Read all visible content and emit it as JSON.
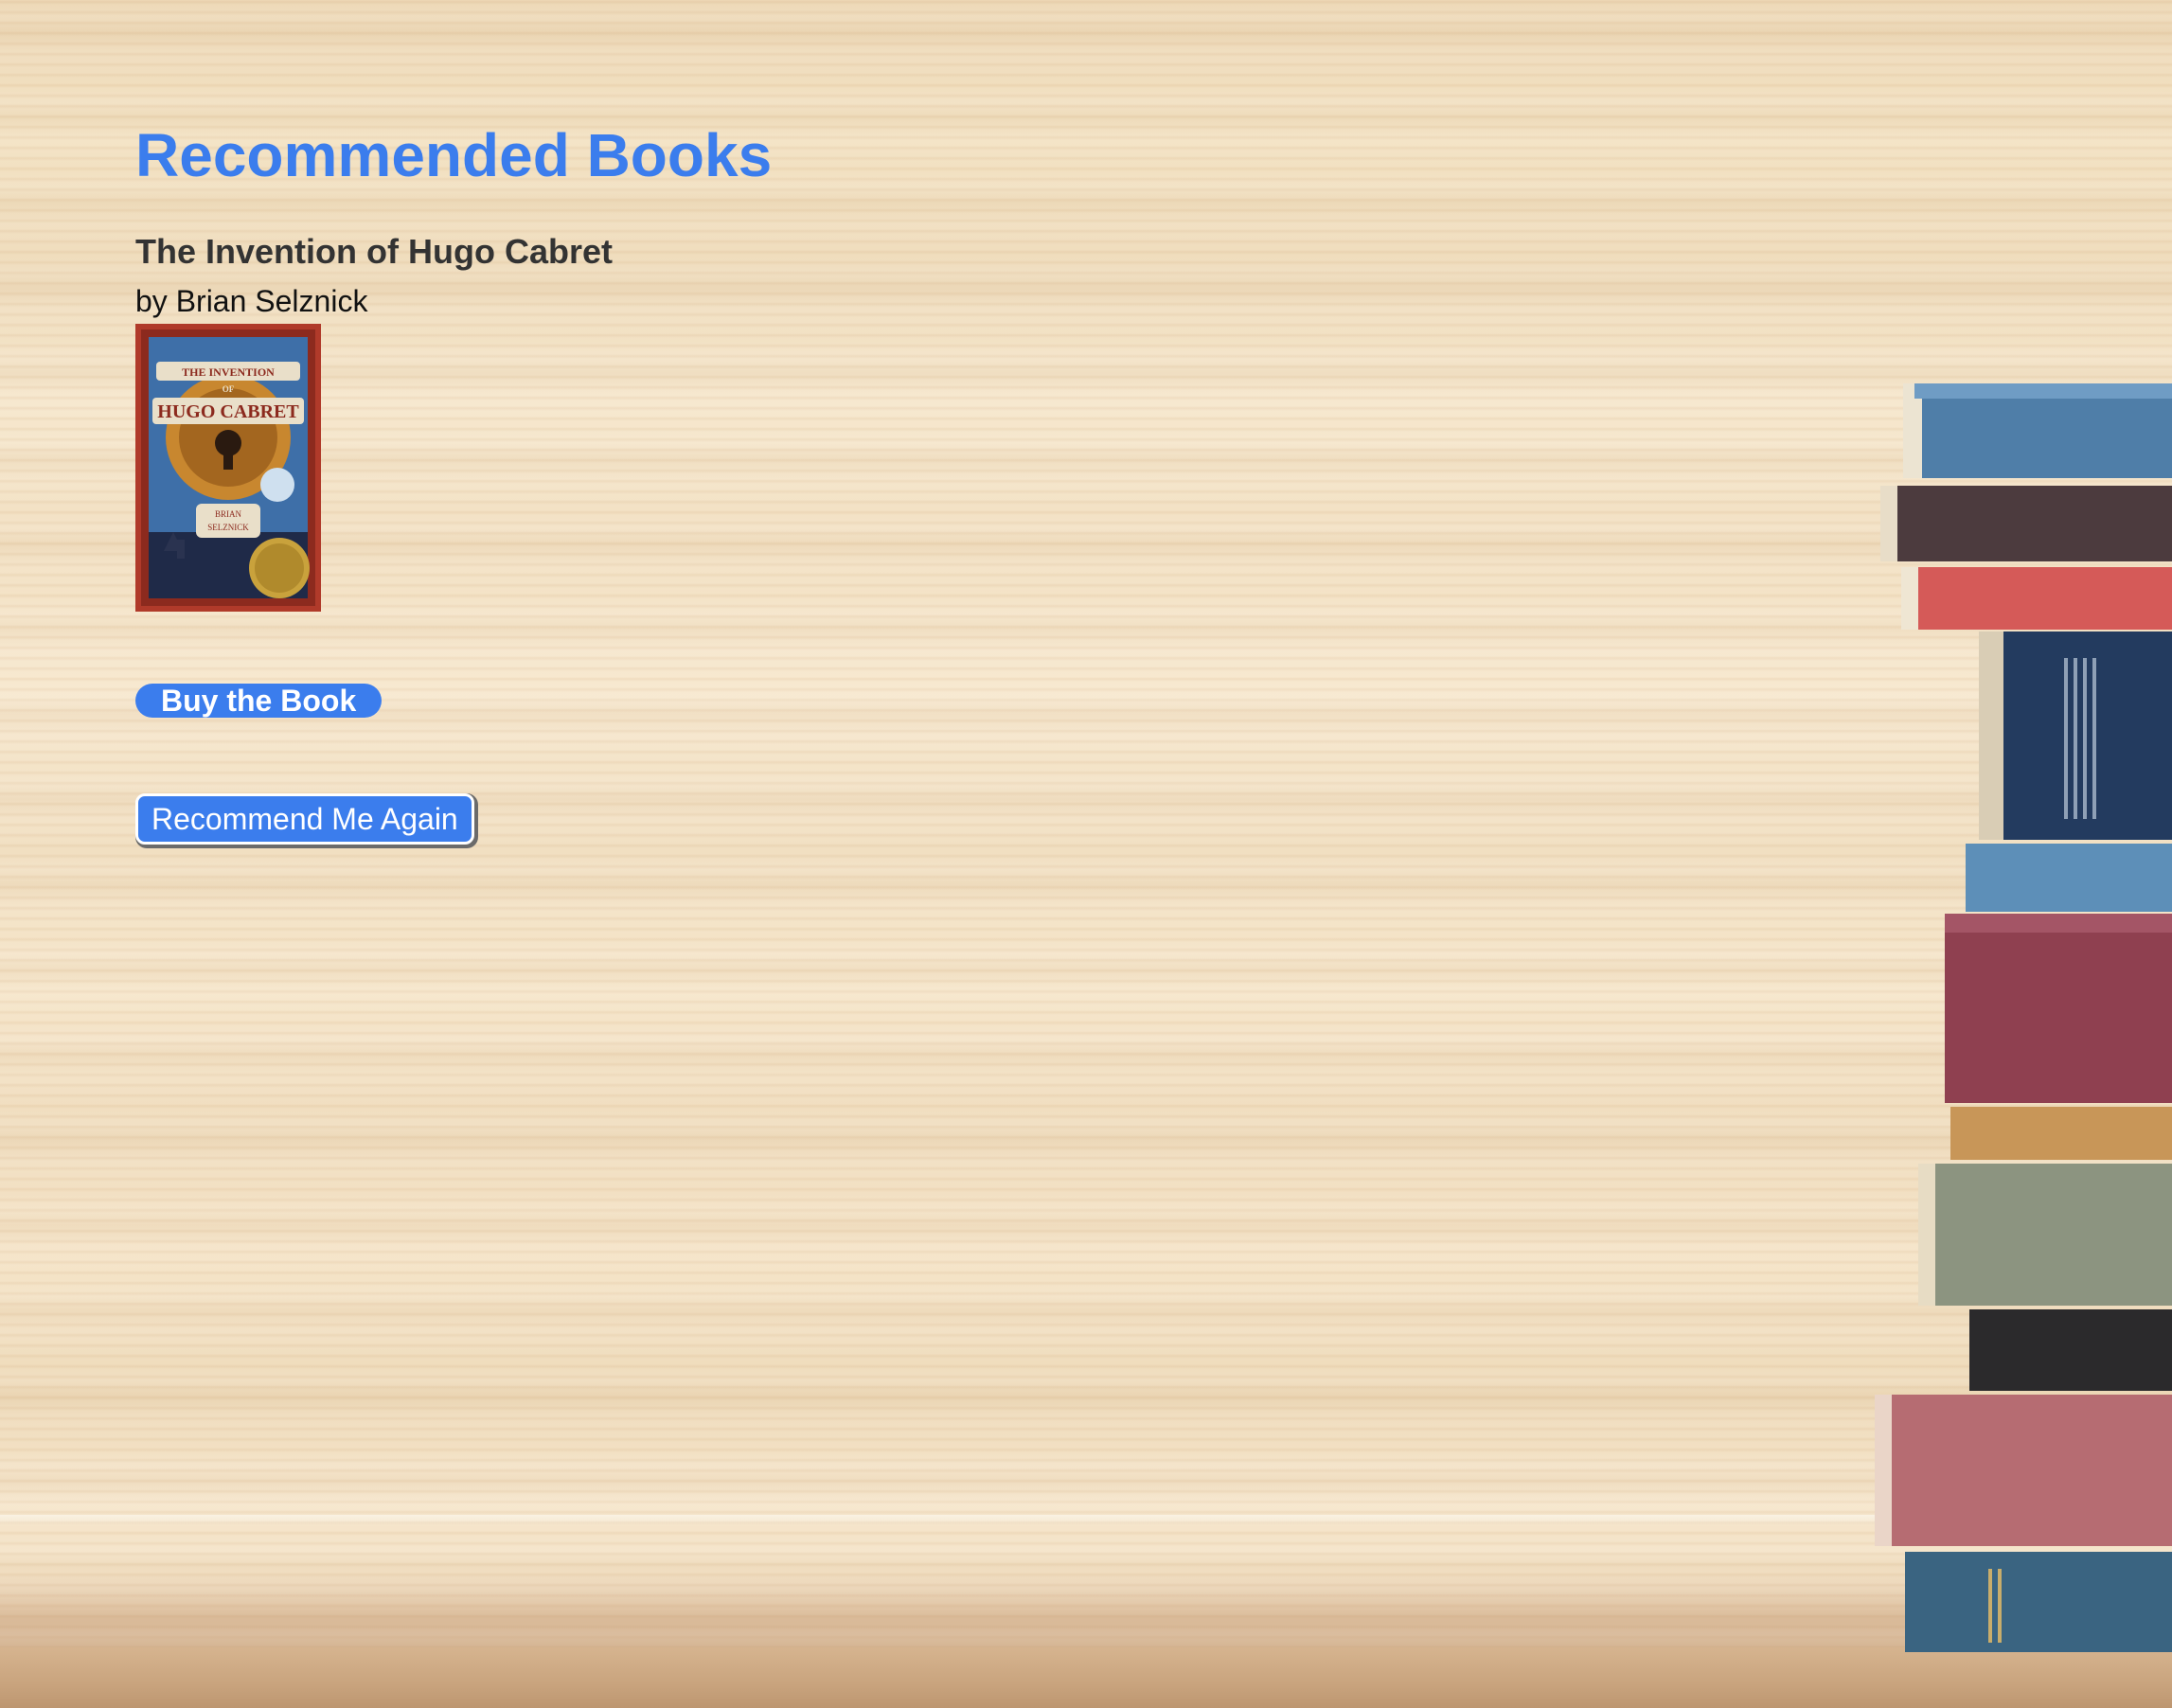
{
  "header": {
    "title": "Recommended Books"
  },
  "recommendation": {
    "book_title": "The Invention of Hugo Cabret",
    "author": "by Brian Selznick",
    "cover_text": {
      "top": "THE INVENTION",
      "of": "OF",
      "main": "HUGO CABRET",
      "author_top": "BRIAN",
      "author_bottom": "SELZNICK"
    }
  },
  "actions": {
    "buy_label": "Buy the Book",
    "again_label": "Recommend Me Again"
  },
  "colors": {
    "accent": "#3b7ded",
    "heading": "#333333"
  }
}
